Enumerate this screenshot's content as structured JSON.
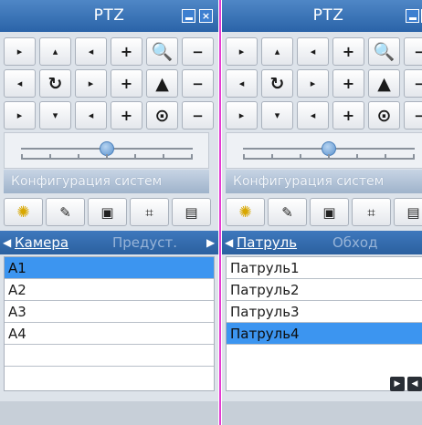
{
  "left_panel": {
    "title": "PTZ",
    "window_buttons": {
      "minimize_icon": "minimize-icon",
      "close_label": "×"
    },
    "controls": [
      [
        "▸",
        "▴",
        "◂",
        "+",
        "🔍",
        "−"
      ],
      [
        "◂",
        "↻",
        "▸",
        "+",
        "▲",
        "−"
      ],
      [
        "▸",
        "▾",
        "◂",
        "+",
        "⊙",
        "−"
      ]
    ],
    "config_label": "Конфигурация систем",
    "tools": [
      "✺",
      "✎",
      "▣",
      "⌗",
      "▤"
    ],
    "tabs": {
      "active": "Камера",
      "inactive": "Предуст.",
      "left_arrow": "◀",
      "right_arrow": "▶"
    },
    "list": [
      {
        "label": "A1",
        "selected": true
      },
      {
        "label": "A2",
        "selected": false
      },
      {
        "label": "A3",
        "selected": false
      },
      {
        "label": "A4",
        "selected": false
      },
      {
        "label": "",
        "selected": false
      }
    ]
  },
  "right_panel": {
    "title": "PTZ",
    "window_buttons": {
      "minimize_icon": "minimize-icon",
      "close_label": "×"
    },
    "controls": [
      [
        "▸",
        "▴",
        "◂",
        "+",
        "🔍",
        "−"
      ],
      [
        "◂",
        "↻",
        "▸",
        "+",
        "▲",
        "−"
      ],
      [
        "▸",
        "▾",
        "◂",
        "+",
        "⊙",
        "−"
      ]
    ],
    "config_label": "Конфигурация систем",
    "tools": [
      "✺",
      "✎",
      "▣",
      "⌗",
      "▤"
    ],
    "tabs": {
      "active": "Патруль",
      "inactive": "Обход",
      "left_arrow": "◀"
    },
    "list": [
      {
        "label": "Патруль1",
        "selected": false
      },
      {
        "label": "Патруль2",
        "selected": false
      },
      {
        "label": "Патруль3",
        "selected": false
      },
      {
        "label": "Патруль4",
        "selected": true
      }
    ],
    "nav_buttons": [
      "▶",
      "◀"
    ]
  },
  "colors": {
    "title_bar": "#2f6bb0",
    "selection": "#3c95f0",
    "divider": "#e43bd2"
  }
}
